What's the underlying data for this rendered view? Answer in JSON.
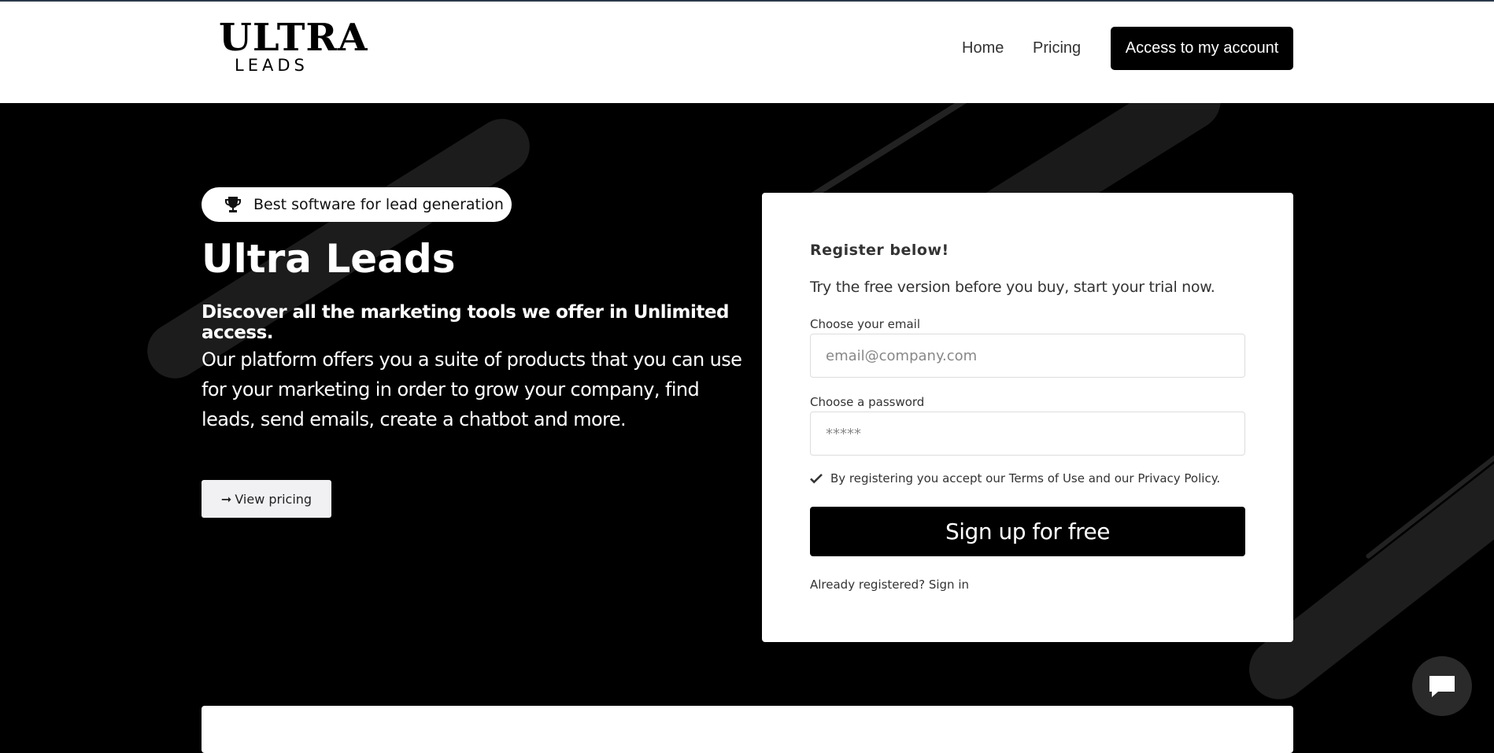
{
  "header": {
    "logo_top": "ULTRA",
    "logo_bottom": "LEADS",
    "nav": [
      "Home",
      "Pricing"
    ],
    "account_button": "Access to my account"
  },
  "hero": {
    "badge": "Best software for lead generation",
    "title": "Ultra Leads",
    "subtitle": "Discover all the marketing tools we offer in Unlimited access.",
    "description": "Our platform offers you a suite of products that you can use for your marketing in order to grow your company, find leads, send emails, create a chatbot and more.",
    "pricing_button": "View pricing"
  },
  "register": {
    "title": "Register below!",
    "trial": "Try the free version before you buy, start your trial now.",
    "email_label": "Choose your email",
    "email_placeholder": "email@company.com",
    "password_label": "Choose a password",
    "password_placeholder": "*****",
    "terms": "By registering you accept our Terms of Use and our Privacy Policy.",
    "signup_button": "Sign up for free",
    "already": "Already registered? Sign in"
  },
  "icons": {
    "badge": "trophy-icon",
    "pricing": "arrow-right-icon",
    "terms": "check-icon",
    "chat": "chat-icon"
  },
  "colors": {
    "hero_background": "#000000",
    "primary_button": "#000000"
  }
}
